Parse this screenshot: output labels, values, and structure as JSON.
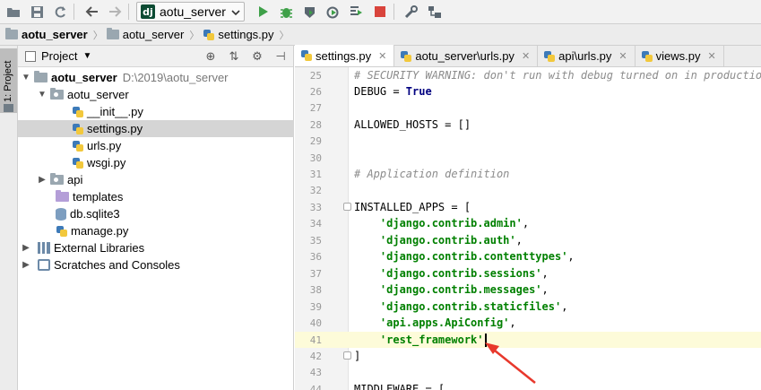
{
  "toolbar": {
    "run_config": "aotu_server",
    "colors": {
      "run": "#3ea048",
      "debug": "#3ea048",
      "stop": "#d9443c"
    }
  },
  "breadcrumb": [
    "aotu_server",
    "aotu_server",
    "settings.py"
  ],
  "stripe": {
    "label": "1: Project"
  },
  "project": {
    "title": "Project",
    "root": {
      "name": "aotu_server",
      "path": "D:\\2019\\aotu_server"
    },
    "items": [
      {
        "label": "aotu_server"
      },
      {
        "label": "__init__.py"
      },
      {
        "label": "settings.py"
      },
      {
        "label": "urls.py"
      },
      {
        "label": "wsgi.py"
      },
      {
        "label": "api"
      },
      {
        "label": "templates"
      },
      {
        "label": "db.sqlite3"
      },
      {
        "label": "manage.py"
      },
      {
        "label": "External Libraries"
      },
      {
        "label": "Scratches and Consoles"
      }
    ]
  },
  "tabs": [
    {
      "label": "settings.py"
    },
    {
      "label": "aotu_server\\urls.py"
    },
    {
      "label": "api\\urls.py"
    },
    {
      "label": "views.py"
    }
  ],
  "code": {
    "lines": [
      {
        "n": "25",
        "text": "# SECURITY WARNING: don't run with debug turned on in production!"
      },
      {
        "n": "26",
        "a": "DEBUG = ",
        "b": "True"
      },
      {
        "n": "27",
        "text": ""
      },
      {
        "n": "28",
        "text": "ALLOWED_HOSTS = []"
      },
      {
        "n": "29",
        "text": ""
      },
      {
        "n": "30",
        "text": ""
      },
      {
        "n": "31",
        "text": "# Application definition"
      },
      {
        "n": "32",
        "text": ""
      },
      {
        "n": "33",
        "text": "INSTALLED_APPS = ["
      },
      {
        "n": "34",
        "s": "'django.contrib.admin'"
      },
      {
        "n": "35",
        "s": "'django.contrib.auth'"
      },
      {
        "n": "36",
        "s": "'django.contrib.contenttypes'"
      },
      {
        "n": "37",
        "s": "'django.contrib.sessions'"
      },
      {
        "n": "38",
        "s": "'django.contrib.messages'"
      },
      {
        "n": "39",
        "s": "'django.contrib.staticfiles'"
      },
      {
        "n": "40",
        "s": "'api.apps.ApiConfig'"
      },
      {
        "n": "41",
        "s": "'rest_framework'"
      },
      {
        "n": "42",
        "text": "]"
      },
      {
        "n": "43",
        "text": ""
      },
      {
        "n": "44",
        "text": "MIDDLEWARE = ["
      }
    ]
  }
}
